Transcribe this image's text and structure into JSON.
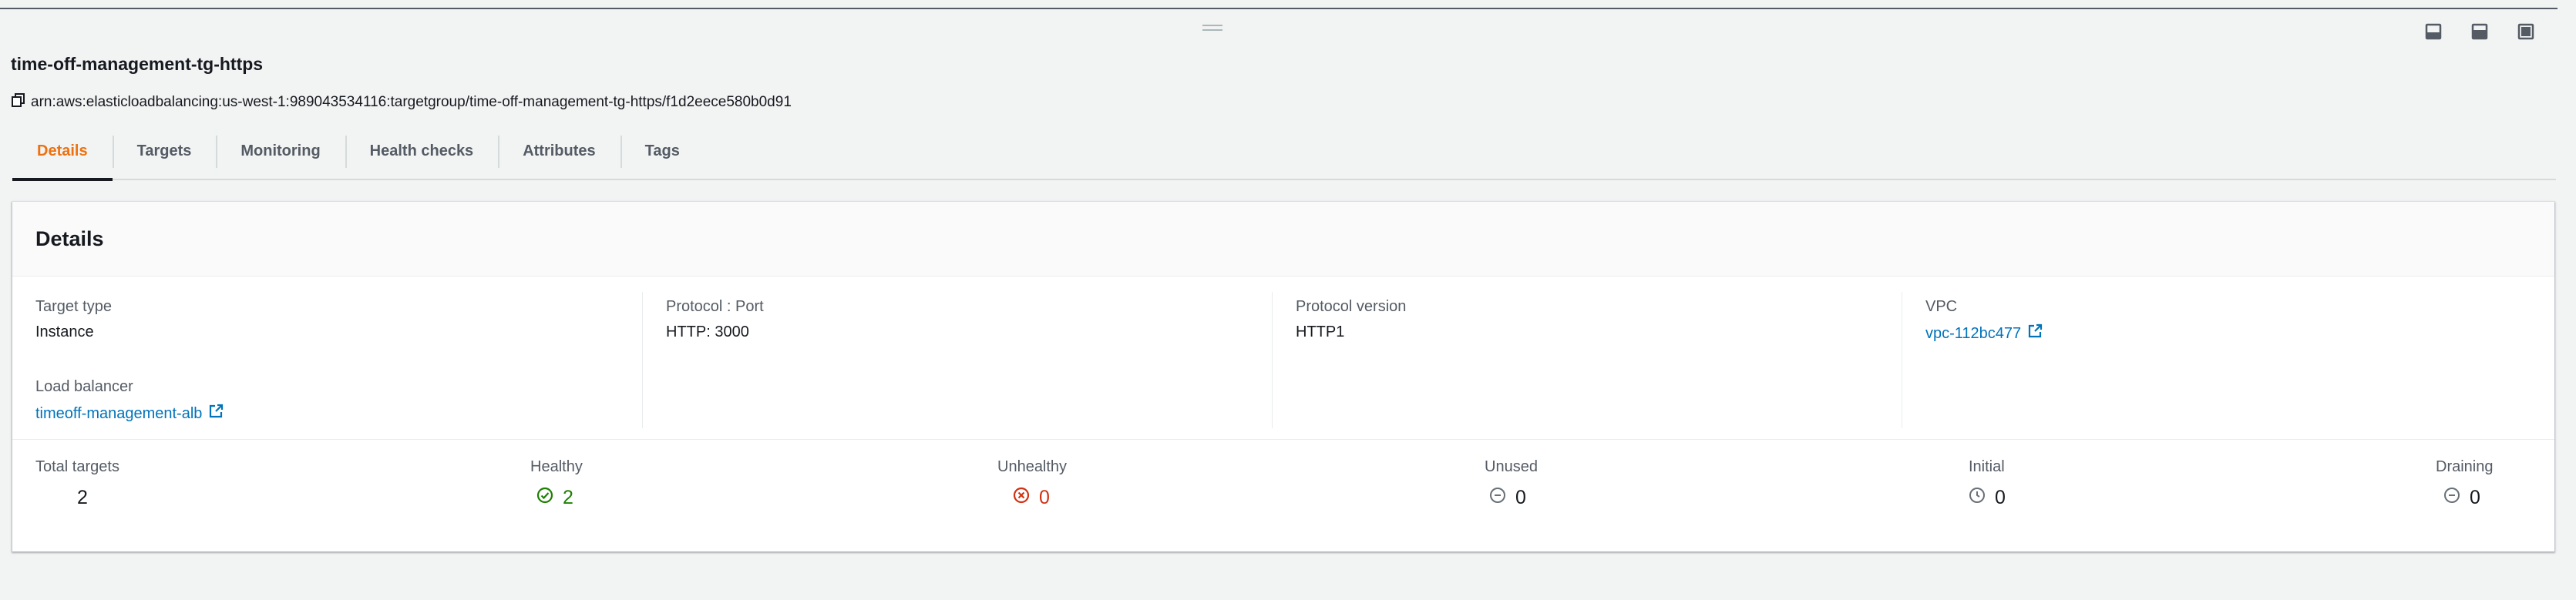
{
  "panel": {
    "title": "time-off-management-tg-https",
    "arn": "arn:aws:elasticloadbalancing:us-west-1:989043534116:targetgroup/time-off-management-tg-https/f1d2eece580b0d91"
  },
  "tabs": [
    "Details",
    "Targets",
    "Monitoring",
    "Health checks",
    "Attributes",
    "Tags"
  ],
  "details": {
    "heading": "Details",
    "target_type": {
      "label": "Target type",
      "value": "Instance"
    },
    "protocol_port": {
      "label": "Protocol : Port",
      "value": "HTTP: 3000"
    },
    "protocol_version": {
      "label": "Protocol version",
      "value": "HTTP1"
    },
    "vpc": {
      "label": "VPC",
      "value": "vpc-112bc477"
    },
    "load_balancer": {
      "label": "Load balancer",
      "value": "timeoff-management-alb"
    }
  },
  "stats": {
    "total": {
      "label": "Total targets",
      "value": "2"
    },
    "healthy": {
      "label": "Healthy",
      "value": "2"
    },
    "unhealthy": {
      "label": "Unhealthy",
      "value": "0"
    },
    "unused": {
      "label": "Unused",
      "value": "0"
    },
    "initial": {
      "label": "Initial",
      "value": "0"
    },
    "draining": {
      "label": "Draining",
      "value": "0"
    }
  },
  "colors": {
    "accent": "#ec7211",
    "link": "#0073bb",
    "healthy": "#1d8102",
    "unhealthy": "#d13212",
    "muted": "#687078"
  },
  "icons": [
    "split-bottom-icon",
    "split-side-icon",
    "fullscreen-icon",
    "copy-icon",
    "external-link-icon",
    "success-check-icon",
    "error-x-icon",
    "stopped-icon",
    "clock-icon"
  ]
}
